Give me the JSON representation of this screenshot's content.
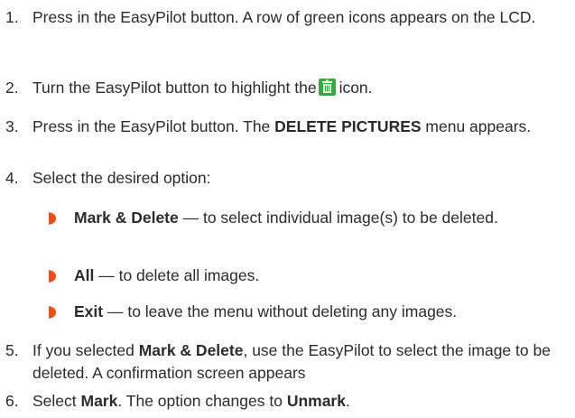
{
  "steps": [
    {
      "num": "1.",
      "text": "Press in the EasyPilot button. A row of green icons appears on the LCD."
    },
    {
      "num": "2.",
      "pre": "Turn the EasyPilot button to highlight the",
      "icon": "trash-icon",
      "post": "icon."
    },
    {
      "num": "3.",
      "pre": "Press in the EasyPilot button. The ",
      "bold": "DELETE PICTURES",
      "post": " menu appears."
    },
    {
      "num": "4.",
      "text": "Select the desired option:"
    },
    {
      "num": "5.",
      "pre": "If you selected ",
      "bold": "Mark & Delete",
      "post": ", use the EasyPilot to select the image to be deleted. A confirmation screen appears"
    },
    {
      "num": "6.",
      "pre": "Select ",
      "bold": "Mark",
      "mid": ". The option changes to ",
      "bold2": "Unmark",
      "post": "."
    }
  ],
  "options": [
    {
      "label": "Mark & Delete",
      "desc": " — to select individual image(s) to be deleted."
    },
    {
      "label": "All",
      "desc": " — to delete all images."
    },
    {
      "label": "Exit",
      "desc": " — to leave the menu without deleting any images."
    }
  ],
  "colors": {
    "text": "#2b2b2b",
    "bullet": "#e8501b",
    "icon_bg": "#2fae3c",
    "icon_fg": "#ffffff"
  }
}
